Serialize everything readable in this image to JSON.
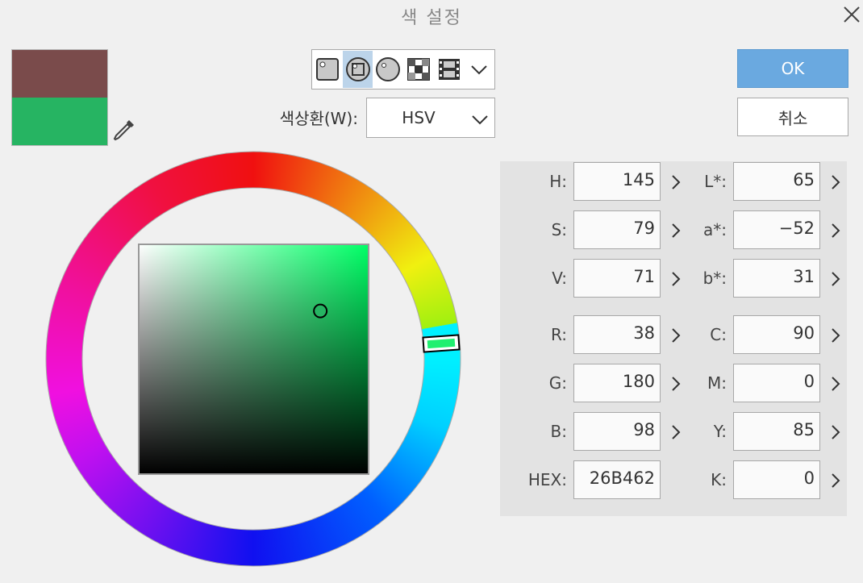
{
  "window": {
    "title": "색 설정"
  },
  "swatches": {
    "main_color": "#7a4b4b",
    "sub_color": "#26b462"
  },
  "modes": [
    "square-mode-icon",
    "hsv-ring-mode-icon",
    "circle-mode-icon",
    "grid-mode-icon",
    "film-mode-icon"
  ],
  "ring": {
    "label": "색상환(W):",
    "selected": "HSV"
  },
  "buttons": {
    "ok": "OK",
    "cancel": "취소"
  },
  "picker": {
    "hue": 145,
    "saturation": 79,
    "value": 71
  },
  "fields": {
    "left": [
      {
        "label": "H:",
        "value": "145"
      },
      {
        "label": "S:",
        "value": "79"
      },
      {
        "label": "V:",
        "value": "71"
      },
      {
        "label": "R:",
        "value": "38"
      },
      {
        "label": "G:",
        "value": "180"
      },
      {
        "label": "B:",
        "value": "98"
      },
      {
        "label": "HEX:",
        "value": "26B462"
      }
    ],
    "right": [
      {
        "label": "L*:",
        "value": "65"
      },
      {
        "label": "a*:",
        "value": "−52"
      },
      {
        "label": "b*:",
        "value": "31"
      },
      {
        "label": "C:",
        "value": "90"
      },
      {
        "label": "M:",
        "value": "0"
      },
      {
        "label": "Y:",
        "value": "85"
      },
      {
        "label": "K:",
        "value": "0"
      }
    ]
  },
  "colors": {
    "accent": "#6aa9e0",
    "selected_green": "#26b462"
  }
}
